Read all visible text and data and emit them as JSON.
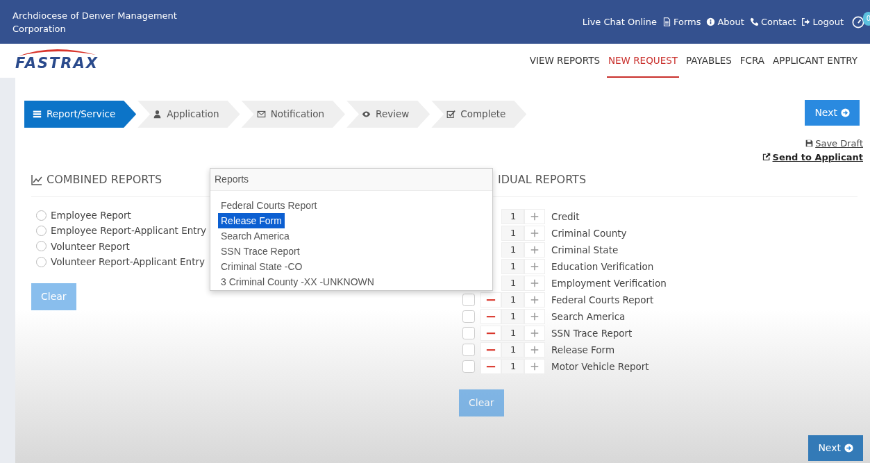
{
  "header": {
    "org": "Archdiocese of Denver Management Corporation",
    "links": [
      {
        "label": "Live Chat Online"
      },
      {
        "label": "Forms"
      },
      {
        "label": "About"
      },
      {
        "label": "Contact"
      },
      {
        "label": "Logout"
      }
    ],
    "badge": "0"
  },
  "logo": "FASTRAX",
  "nav": [
    {
      "label": "VIEW REPORTS",
      "selected": false
    },
    {
      "label": "NEW REQUEST",
      "selected": true
    },
    {
      "label": "PAYABLES",
      "selected": false
    },
    {
      "label": "FCRA",
      "selected": false
    },
    {
      "label": "APPLICANT ENTRY",
      "selected": false
    }
  ],
  "steps": [
    {
      "label": "Report/Service",
      "selected": true
    },
    {
      "label": "Application",
      "selected": false
    },
    {
      "label": "Notification",
      "selected": false
    },
    {
      "label": "Review",
      "selected": false
    },
    {
      "label": "Complete",
      "selected": false
    }
  ],
  "actions": {
    "next": "Next",
    "save_draft": "Save Draft",
    "send": "Send to Applicant"
  },
  "combined": {
    "title": "COMBINED REPORTS",
    "clear": "Clear",
    "clear_disabled": true,
    "options": [
      {
        "label": "Employee Report",
        "selected": false
      },
      {
        "label": "Employee Report-Applicant Entry",
        "selected": false
      },
      {
        "label": "Volunteer Report",
        "selected": false
      },
      {
        "label": "Volunteer Report-Applicant Entry",
        "selected": false
      }
    ]
  },
  "popover": {
    "title": "Reports",
    "items": [
      {
        "label": "Federal Courts Report",
        "selected": false
      },
      {
        "label": "Release Form",
        "selected": true
      },
      {
        "label": "Search America",
        "selected": false
      },
      {
        "label": "SSN Trace Report",
        "selected": false
      },
      {
        "label": "Criminal State -CO",
        "selected": false
      },
      {
        "label": "3 Criminal County -XX -UNKNOWN",
        "selected": false
      }
    ]
  },
  "individual": {
    "title": "IDUAL REPORTS",
    "clear": "Clear",
    "clear_disabled": true,
    "rows": [
      {
        "label": "Credit",
        "quantity": "1",
        "covered": true
      },
      {
        "label": "Criminal County",
        "quantity": "1",
        "covered": true
      },
      {
        "label": "Criminal State",
        "quantity": "1",
        "covered": true
      },
      {
        "label": "Education Verification",
        "quantity": "1",
        "covered": true
      },
      {
        "label": "Employment Verification",
        "quantity": "1",
        "covered": true
      },
      {
        "label": "Federal Courts Report",
        "quantity": "1",
        "checked": false,
        "covered": false
      },
      {
        "label": "Search America",
        "quantity": "1",
        "checked": false,
        "covered": false
      },
      {
        "label": "SSN Trace Report",
        "quantity": "1",
        "checked": false,
        "covered": false
      },
      {
        "label": "Release Form",
        "quantity": "1",
        "checked": false,
        "covered": false
      },
      {
        "label": "Motor Vehicle Report",
        "quantity": "1",
        "checked": false,
        "covered": false
      }
    ]
  },
  "footer": {
    "next": "Next"
  }
}
